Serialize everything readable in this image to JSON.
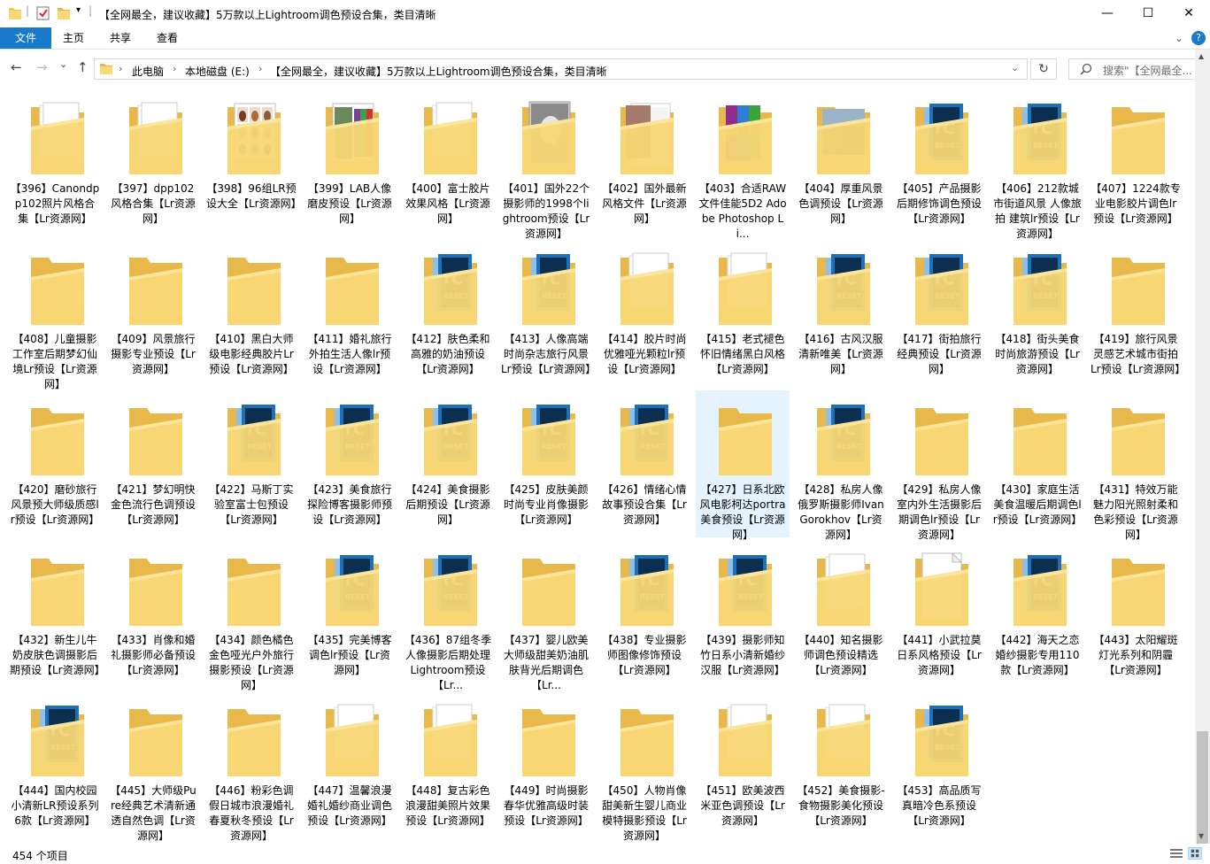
{
  "window": {
    "title": "【全网最全，建议收藏】5万款以上Lightroom调色预设合集，类目清晰",
    "qa_divider": "|",
    "minimize": "—",
    "maximize": "☐",
    "close": "✕"
  },
  "ribbon": {
    "tabs": [
      "文件",
      "主页",
      "共享",
      "查看"
    ],
    "expand": "⌄",
    "help": "?"
  },
  "nav": {
    "back": "←",
    "forward": "→",
    "recent": "⌄",
    "up": "↑",
    "breadcrumb": [
      "此电脑",
      "本地磁盘 (E:)",
      "【全网最全，建议收藏】5万款以上Lightroom调色预设合集，类目清晰"
    ],
    "sep": "›",
    "dropdown": "⌄",
    "refresh": "↻"
  },
  "search": {
    "placeholder": "搜索\"【全网最全...",
    "icon": "search-icon"
  },
  "colors": {
    "folder_front": "#f8d775",
    "folder_back": "#e8b94a",
    "lr_blue": "#1d6fb8",
    "lr_dark": "#0c2f4f",
    "selection": "#e5f3ff",
    "file_tab": "#1979ca"
  },
  "items": [
    {
      "label": "【396】Canondpp102照片风格合集【Lr资源网】",
      "icon": "folder-docs"
    },
    {
      "label": "【397】dpp102风格合集【Lr资源网】",
      "icon": "folder-docs"
    },
    {
      "label": "【398】96组LR预设大全【Lr资源网】",
      "icon": "folder-photo-grid"
    },
    {
      "label": "【399】LAB人像磨皮预设【Lr资源网】",
      "icon": "folder-photo-color"
    },
    {
      "label": "【400】富士胶片效果风格【Lr资源网】",
      "icon": "folder-docs"
    },
    {
      "label": "【401】国外22个摄影师的1998个lightroom预设【Lr资源网】",
      "icon": "folder-photo-face"
    },
    {
      "label": "【402】国外最新风格文件【Lr资源网】",
      "icon": "folder-photo-doc"
    },
    {
      "label": "【403】合适RAW文件佳能5D2 Adobe Photoshop Li...",
      "icon": "folder-archive"
    },
    {
      "label": "【404】厚重风景色调预设【Lr资源网】",
      "icon": "folder-photo-landscape"
    },
    {
      "label": "【405】产品摄影后期修饰调色预设【Lr资源网】",
      "icon": "folder-lr"
    },
    {
      "label": "【406】212款城市街道风景 人像旅拍 建筑lr预设【Lr资源网】",
      "icon": "folder-lr"
    },
    {
      "label": "【407】1224款专业电影胶片调色lr预设【Lr资源网】",
      "icon": "folder-plain"
    },
    {
      "label": "【408】儿童摄影工作室后期梦幻仙境Lr预设【Lr资源网】",
      "icon": "folder-plain"
    },
    {
      "label": "【409】风景旅行摄影专业预设【Lr资源网】",
      "icon": "folder-plain"
    },
    {
      "label": "【410】黑白大师级电影经典胶片Lr预设【Lr资源网】",
      "icon": "folder-plain"
    },
    {
      "label": "【411】婚礼旅行外拍生活人像lr预设【Lr资源网】",
      "icon": "folder-plain"
    },
    {
      "label": "【412】肤色柔和高雅的奶油预设【Lr资源网】",
      "icon": "folder-lr"
    },
    {
      "label": "【413】人像高端时尚杂志旅行风景Lr预设【Lr资源网】",
      "icon": "folder-lr"
    },
    {
      "label": "【414】胶片时尚优雅哑光颗粒lr预设【Lr资源网】",
      "icon": "folder-docs"
    },
    {
      "label": "【415】老式褪色怀旧情绪黑白风格【Lr资源网】",
      "icon": "folder-docs"
    },
    {
      "label": "【416】古风汉服清新唯美【Lr资源网】",
      "icon": "folder-lr"
    },
    {
      "label": "【417】街拍旅行经典预设【Lr资源网】",
      "icon": "folder-lr"
    },
    {
      "label": "【418】街头美食时尚旅游预设【Lr资源网】",
      "icon": "folder-lr"
    },
    {
      "label": "【419】旅行风景灵感艺术城市街拍Lr预设【Lr资源网】",
      "icon": "folder-plain"
    },
    {
      "label": "【420】磨砂旅行风景预大师级质感lr预设【Lr资源网】",
      "icon": "folder-plain"
    },
    {
      "label": "【421】梦幻明快金色流行色调预设【Lr资源网】",
      "icon": "folder-plain"
    },
    {
      "label": "【422】马斯丁实验室富士包预设【Lr资源网】",
      "icon": "folder-lr"
    },
    {
      "label": "【423】美食旅行探险博客摄影师预设【Lr资源网】",
      "icon": "folder-lr"
    },
    {
      "label": "【424】美食摄影后期预设【Lr资源网】",
      "icon": "folder-lr"
    },
    {
      "label": "【425】皮肤美颜时尚专业肖像摄影【Lr资源网】",
      "icon": "folder-lr"
    },
    {
      "label": "【426】情绪心情故事预设合集【Lr资源网】",
      "icon": "folder-lr"
    },
    {
      "label": "【427】日系北欧风电影柯达portra美食预设【Lr资源网】",
      "icon": "folder-plain",
      "selected": true
    },
    {
      "label": "【428】私房人像 俄罗斯摄影师Ivan Gorokhov【Lr资源网】",
      "icon": "folder-lr"
    },
    {
      "label": "【429】私房人像室内外生活摄影后期调色lr预设【Lr资源网】",
      "icon": "folder-plain"
    },
    {
      "label": "【430】家庭生活美食温暖后期调色lr预设【Lr资源网】",
      "icon": "folder-plain"
    },
    {
      "label": "【431】特效万能魅力阳光照射柔和色彩预设【Lr资源网】",
      "icon": "folder-plain"
    },
    {
      "label": "【432】新生儿牛奶皮肤色调摄影后期预设【Lr资源网】",
      "icon": "folder-plain"
    },
    {
      "label": "【433】肖像和婚礼摄影师必备预设【Lr资源网】",
      "icon": "folder-plain"
    },
    {
      "label": "【434】颜色橘色金色哑光户外旅行摄影预设【Lr资源网】",
      "icon": "folder-plain"
    },
    {
      "label": "【435】完美博客调色lr预设【Lr资源网】",
      "icon": "folder-lr"
    },
    {
      "label": "【436】87组冬季人像摄影后期处理Lightroom预设【Lr...",
      "icon": "folder-lr"
    },
    {
      "label": "【437】婴儿欧美大师级甜美奶油肌肤背光后期调色【Lr...",
      "icon": "folder-plain"
    },
    {
      "label": "【438】专业摄影师图像修饰预设【Lr资源网】",
      "icon": "folder-lr"
    },
    {
      "label": "【439】摄影师知竹日系小清新婚纱汉服【Lr资源网】",
      "icon": "folder-lr"
    },
    {
      "label": "【440】知名摄影师调色预设精选【Lr资源网】",
      "icon": "folder-docs"
    },
    {
      "label": "【441】小武拉莫日系风格预设【Lr资源网】",
      "icon": "folder-blank"
    },
    {
      "label": "【442】海天之恋婚纱摄影专用110款【Lr资源网】",
      "icon": "folder-lr"
    },
    {
      "label": "【443】太阳耀斑灯光系列和阴霾【Lr资源网】",
      "icon": "folder-plain"
    },
    {
      "label": "【444】国内校园小清新LR预设系列6款【Lr资源网】",
      "icon": "folder-lr"
    },
    {
      "label": "【445】大师级Pure经典艺术清新通透自然色调【Lr资源网】",
      "icon": "folder-plain"
    },
    {
      "label": "【446】粉彩色调假日城市浪漫婚礼春夏秋冬预设【Lr资源网】",
      "icon": "folder-plain"
    },
    {
      "label": "【447】温馨浪漫婚礼婚纱商业调色预设【Lr资源网】",
      "icon": "folder-docs"
    },
    {
      "label": "【448】复古彩色浪漫甜美照片效果预设【Lr资源网】",
      "icon": "folder-docs"
    },
    {
      "label": "【449】时尚摄影春华优雅高级时装预设【Lr资源网】",
      "icon": "folder-plain"
    },
    {
      "label": "【450】人物肖像甜美新生婴儿商业模特摄影预设【Lr资源网】",
      "icon": "folder-plain"
    },
    {
      "label": "【451】欧美波西米亚色调预设【Lr资源网】",
      "icon": "folder-docs"
    },
    {
      "label": "【452】美食摄影-食物摄影美化预设【Lr资源网】",
      "icon": "folder-docs"
    },
    {
      "label": "【453】高品质写真暗冷色系预设【Lr资源网】",
      "icon": "folder-lr"
    }
  ],
  "status": {
    "count_text": "454 个项目"
  }
}
